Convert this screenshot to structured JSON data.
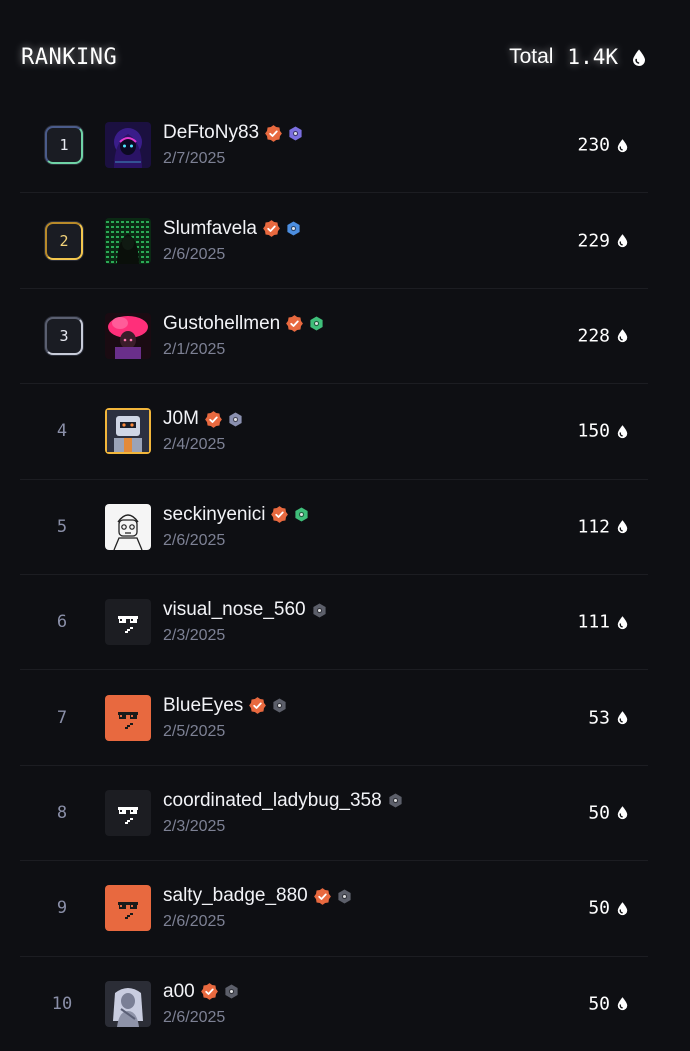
{
  "header": {
    "title": "RANKING",
    "total_label": "Total",
    "total_value": "1.4K"
  },
  "colors": {
    "background": "#0e0f13",
    "verified": "#e8693f",
    "orange_avatar": "#e8693f"
  },
  "rows": [
    {
      "rank": "1",
      "name": "DeFtoNy83",
      "date": "2/7/2025",
      "score": "230",
      "verified": true,
      "tier_color": "#7b6fe0",
      "avatar": "neon-hood-avatar"
    },
    {
      "rank": "2",
      "name": "Slumfavela",
      "date": "2/6/2025",
      "score": "229",
      "verified": true,
      "tier_color": "#4c8ee0",
      "avatar": "matrix-avatar"
    },
    {
      "rank": "3",
      "name": "Gustohellmen",
      "date": "2/1/2025",
      "score": "228",
      "verified": true,
      "tier_color": "#3fbf7a",
      "avatar": "pink-hair-avatar"
    },
    {
      "rank": "4",
      "name": "J0M",
      "date": "2/4/2025",
      "score": "150",
      "verified": true,
      "tier_color": "#8a90b0",
      "avatar": "robot-avatar"
    },
    {
      "rank": "5",
      "name": "seckinyenici",
      "date": "2/6/2025",
      "score": "112",
      "verified": true,
      "tier_color": "#3fbf7a",
      "avatar": "sketch-avatar"
    },
    {
      "rank": "6",
      "name": "visual_nose_560",
      "date": "2/3/2025",
      "score": "111",
      "verified": false,
      "tier_color": "#5c5f6a",
      "avatar": "sunglasses-dark-avatar"
    },
    {
      "rank": "7",
      "name": "BlueEyes",
      "date": "2/5/2025",
      "score": "53",
      "verified": true,
      "tier_color": "#5c5f6a",
      "avatar": "sunglasses-orange-avatar"
    },
    {
      "rank": "8",
      "name": "coordinated_ladybug_358",
      "date": "2/3/2025",
      "score": "50",
      "verified": false,
      "tier_color": "#5c5f6a",
      "avatar": "sunglasses-dark-avatar"
    },
    {
      "rank": "9",
      "name": "salty_badge_880",
      "date": "2/6/2025",
      "score": "50",
      "verified": true,
      "tier_color": "#5c5f6a",
      "avatar": "sunglasses-orange-avatar"
    },
    {
      "rank": "10",
      "name": "a00",
      "date": "2/6/2025",
      "score": "50",
      "verified": true,
      "tier_color": "#5c5f6a",
      "avatar": "portrait-avatar"
    }
  ]
}
